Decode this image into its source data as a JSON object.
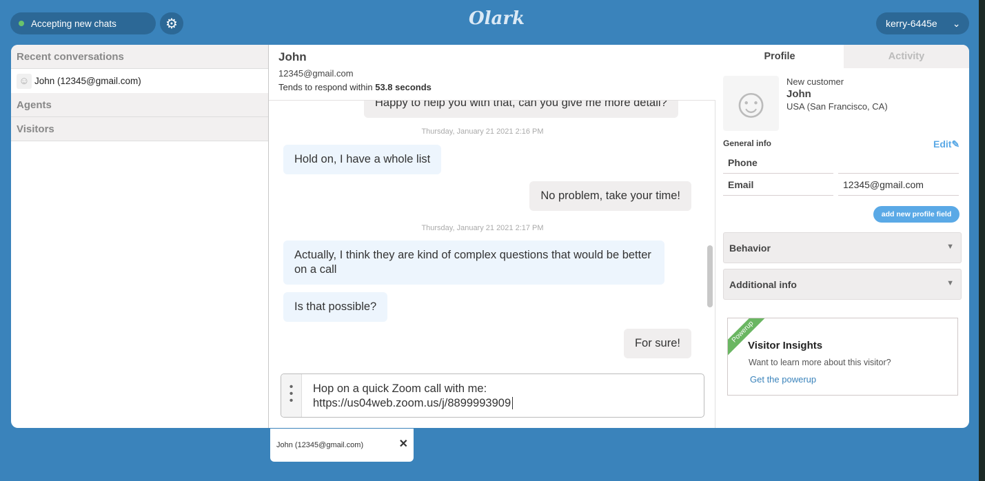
{
  "topbar": {
    "status": "Accepting new chats",
    "status_color": "#6bc36b",
    "logo": "Olark",
    "user": "kerry-6445e"
  },
  "sidebar": {
    "recent": "Recent conversations",
    "conversations": [
      {
        "label": "John (12345@gmail.com)"
      }
    ],
    "agents": "Agents",
    "visitors": "Visitors"
  },
  "chat": {
    "name": "John",
    "email": "12345@gmail.com",
    "respond_prefix": "Tends to respond within",
    "respond_time": "53.8 seconds",
    "messages": [
      {
        "from": "operator",
        "text": "Happy to help you with that, can you give me more detail?"
      },
      {
        "type": "timestamp",
        "text": "Thursday, January 21 2021 2:16 PM"
      },
      {
        "from": "visitor",
        "text": "Hold on, I have a whole list"
      },
      {
        "from": "operator",
        "text": "No problem, take your time!"
      },
      {
        "type": "timestamp",
        "text": "Thursday, January 21 2021 2:17 PM"
      },
      {
        "from": "visitor",
        "text": "Actually, I think they are kind of complex questions that would be better on a call"
      },
      {
        "from": "visitor",
        "text": "Is that possible?"
      },
      {
        "from": "operator",
        "text": "For sure!"
      }
    ],
    "input_line1": "Hop on a quick Zoom call with me:",
    "input_line2": "https://us04web.zoom.us/j/8899993909"
  },
  "profile": {
    "tabs": [
      "Profile",
      "Activity"
    ],
    "customer_type": "New customer",
    "name": "John",
    "location": "USA (San Francisco, CA)",
    "general_info": "General info",
    "edit": "Edit",
    "fields": [
      {
        "label": "Phone",
        "value": ""
      },
      {
        "label": "Email",
        "value": "12345@gmail.com"
      }
    ],
    "add_field": "add new profile field",
    "behavior": "Behavior",
    "additional_info": "Additional info",
    "powerup": {
      "ribbon": "Powerup",
      "title": "Visitor Insights",
      "text": "Want to learn more about this visitor?",
      "link": "Get the powerup"
    }
  },
  "bottom_tab": {
    "label": "John (12345@gmail.com)"
  }
}
